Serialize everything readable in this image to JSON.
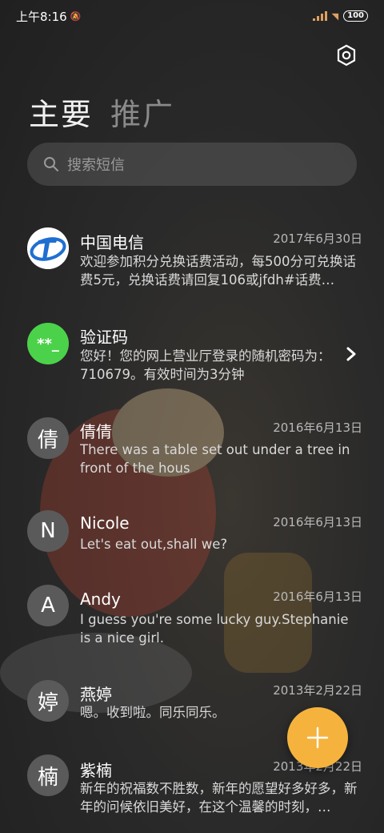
{
  "status_bar": {
    "time": "上午8:16",
    "battery": "100"
  },
  "tabs": [
    {
      "label": "主要",
      "active": true
    },
    {
      "label": "推广",
      "active": false
    }
  ],
  "search": {
    "placeholder": "搜索短信"
  },
  "conversations": [
    {
      "avatar": "",
      "avatar_kind": "telecom-logo",
      "name": "中国电信",
      "date": "2017年6月30日",
      "preview": "欢迎参加积分兑换话费活动，每500分可兑换话费5元，兑换话费请回复106或jfdh#话费…"
    },
    {
      "avatar": "**_",
      "avatar_kind": "green",
      "name": "验证码",
      "date": "",
      "preview": "您好！您的网上营业厅登录的随机密码为：710679。有效时间为3分钟"
    },
    {
      "avatar": "倩",
      "avatar_kind": "gray",
      "name": "倩倩",
      "date": "2016年6月13日",
      "preview": "There was a table set out under a tree in front of the hous"
    },
    {
      "avatar": "N",
      "avatar_kind": "gray",
      "name": "Nicole",
      "date": "2016年6月13日",
      "preview": "Let's eat out,shall we?"
    },
    {
      "avatar": "A",
      "avatar_kind": "gray",
      "name": "Andy",
      "date": "2016年6月13日",
      "preview": "I guess you're some lucky guy.Stephanie is a nice girl."
    },
    {
      "avatar": "婷",
      "avatar_kind": "gray",
      "name": "燕婷",
      "date": "2013年2月22日",
      "preview": "嗯。收到啦。同乐同乐。"
    },
    {
      "avatar": "楠",
      "avatar_kind": "gray",
      "name": "紫楠",
      "date": "2013年2月22日",
      "preview": "新年的祝福数不胜数，新年的愿望好多好多，新年的问候依旧美好，在这个温馨的时刻，…"
    }
  ],
  "colors": {
    "accent_fab": "#f5b33e",
    "verification_green": "#4cd24a",
    "avatar_gray": "#5a5a5a"
  }
}
